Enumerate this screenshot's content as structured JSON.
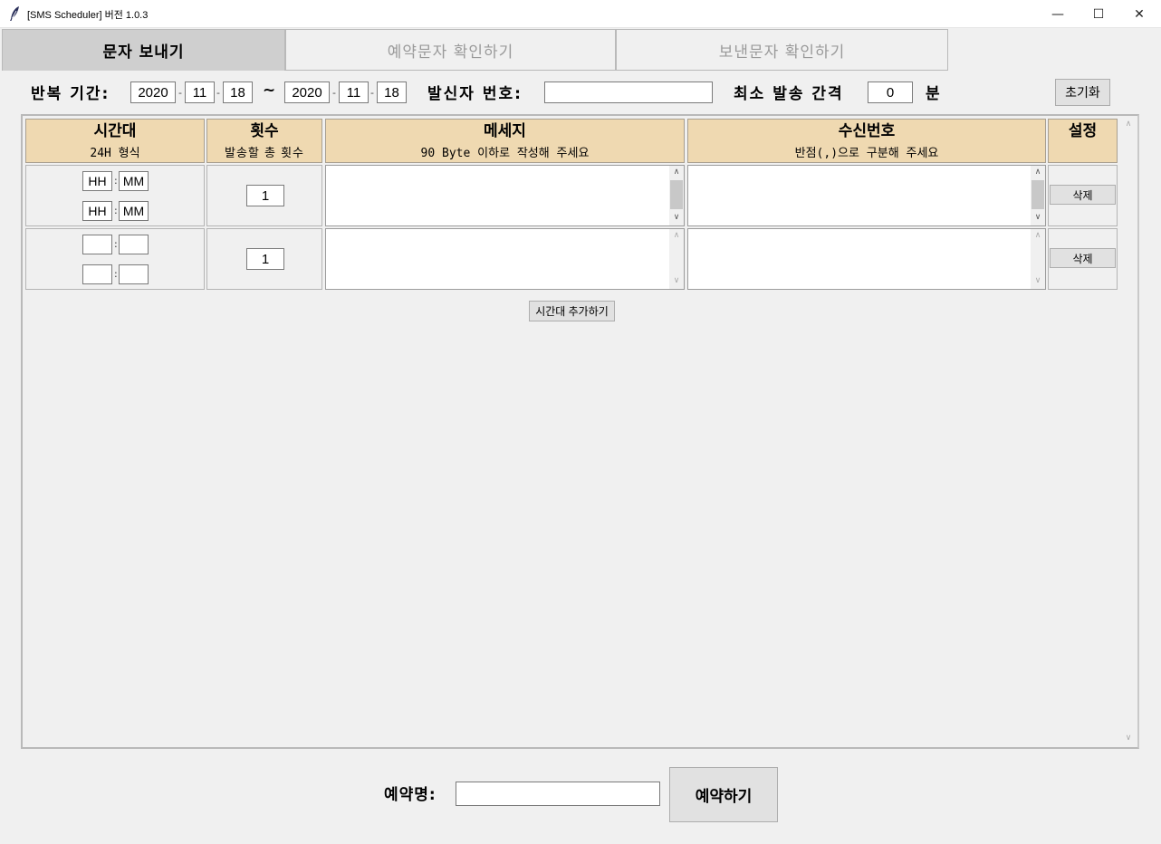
{
  "window": {
    "title": "[SMS Scheduler] 버전 1.0.3",
    "minimize": "—",
    "maximize": "☐",
    "close": "✕"
  },
  "tabs": [
    {
      "label": "문자 보내기",
      "active": true
    },
    {
      "label": "예약문자 확인하기",
      "active": false
    },
    {
      "label": "보낸문자 확인하기",
      "active": false
    }
  ],
  "form": {
    "period_label": "반복 기간:",
    "start": {
      "year": "2020",
      "month": "11",
      "day": "18"
    },
    "tilde": "~",
    "end": {
      "year": "2020",
      "month": "11",
      "day": "18"
    },
    "sep": "-",
    "sender_label": "발신자 번호:",
    "sender_value": "",
    "interval_label": "최소 발송 간격",
    "interval_value": "0",
    "interval_unit": "분",
    "reset_label": "초기화"
  },
  "table": {
    "headers": [
      {
        "title": "시간대",
        "sub": "24H 형식"
      },
      {
        "title": "횟수",
        "sub": "발송할 총 횟수"
      },
      {
        "title": "메세지",
        "sub": "90 Byte 이하로 작성해 주세요"
      },
      {
        "title": "수신번호",
        "sub": "반점(,)으로 구분해 주세요"
      },
      {
        "title": "설정",
        "sub": ""
      }
    ],
    "rows": [
      {
        "start_hh": "HH",
        "start_mm": "MM",
        "end_hh": "HH",
        "end_mm": "MM",
        "count": "1",
        "message": "",
        "recipients": "",
        "delete_label": "삭제"
      },
      {
        "start_hh": "",
        "start_mm": "",
        "end_hh": "",
        "end_mm": "",
        "count": "1",
        "message": "",
        "recipients": "",
        "delete_label": "삭제"
      }
    ],
    "time_sep": ":",
    "add_row_label": "시간대 추가하기"
  },
  "footer": {
    "reservation_label": "예약명:",
    "reservation_value": "",
    "submit_label": "예약하기"
  },
  "colors": {
    "header_bg": "#efd9b1",
    "active_tab_bg": "#cfcfcf",
    "window_bg": "#f0f0f0"
  }
}
